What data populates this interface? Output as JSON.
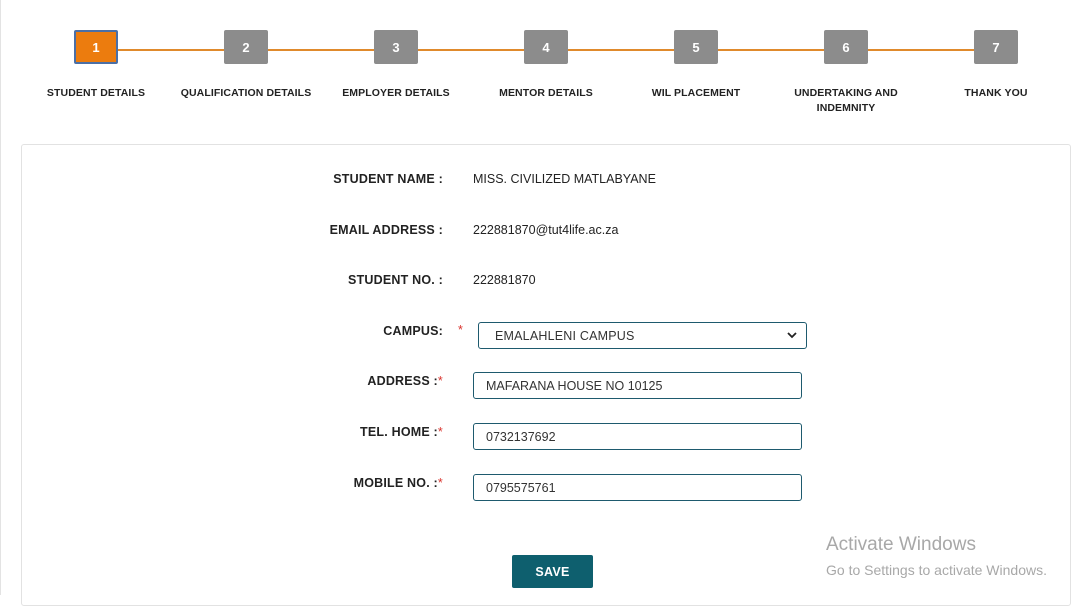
{
  "stepper": {
    "steps": [
      {
        "number": "1",
        "label": "STUDENT DETAILS",
        "active": true
      },
      {
        "number": "2",
        "label": "QUALIFICATION DETAILS",
        "active": false
      },
      {
        "number": "3",
        "label": "EMPLOYER DETAILS",
        "active": false
      },
      {
        "number": "4",
        "label": "MENTOR DETAILS",
        "active": false
      },
      {
        "number": "5",
        "label": "WIL PLACEMENT",
        "active": false
      },
      {
        "number": "6",
        "label_line1": "UNDERTAKING AND",
        "label_line2": "INDEMNITY",
        "active": false
      },
      {
        "number": "7",
        "label": "THANK YOU",
        "active": false
      }
    ],
    "colors": {
      "active": "#ec7c0e",
      "inactive": "#8c8c8c",
      "connector": "#e08a2c"
    }
  },
  "form": {
    "student_name": {
      "label": "STUDENT NAME :",
      "value": "MISS. CIVILIZED MATLABYANE"
    },
    "email": {
      "label": "EMAIL ADDRESS :",
      "value": "222881870@tut4life.ac.za"
    },
    "student_no": {
      "label": "STUDENT NO. :",
      "value": "222881870"
    },
    "campus": {
      "label": "CAMPUS:",
      "required_mark": "*",
      "selected": "EMALAHLENI CAMPUS",
      "icon": "chevron-down-icon"
    },
    "address": {
      "label": "ADDRESS :",
      "required_mark": "*",
      "value": "MAFARANA HOUSE NO 10125"
    },
    "tel_home": {
      "label": "TEL. HOME :",
      "required_mark": "*",
      "value": "0732137692"
    },
    "mobile_no": {
      "label": "MOBILE NO. :",
      "required_mark": "*",
      "value": "0795575761"
    },
    "save_label": "SAVE",
    "colors": {
      "field_border": "#1e5a6e",
      "button": "#0e5f6e",
      "required": "#d9322c"
    }
  },
  "watermark": {
    "title": "Activate Windows",
    "subtitle": "Go to Settings to activate Windows."
  }
}
